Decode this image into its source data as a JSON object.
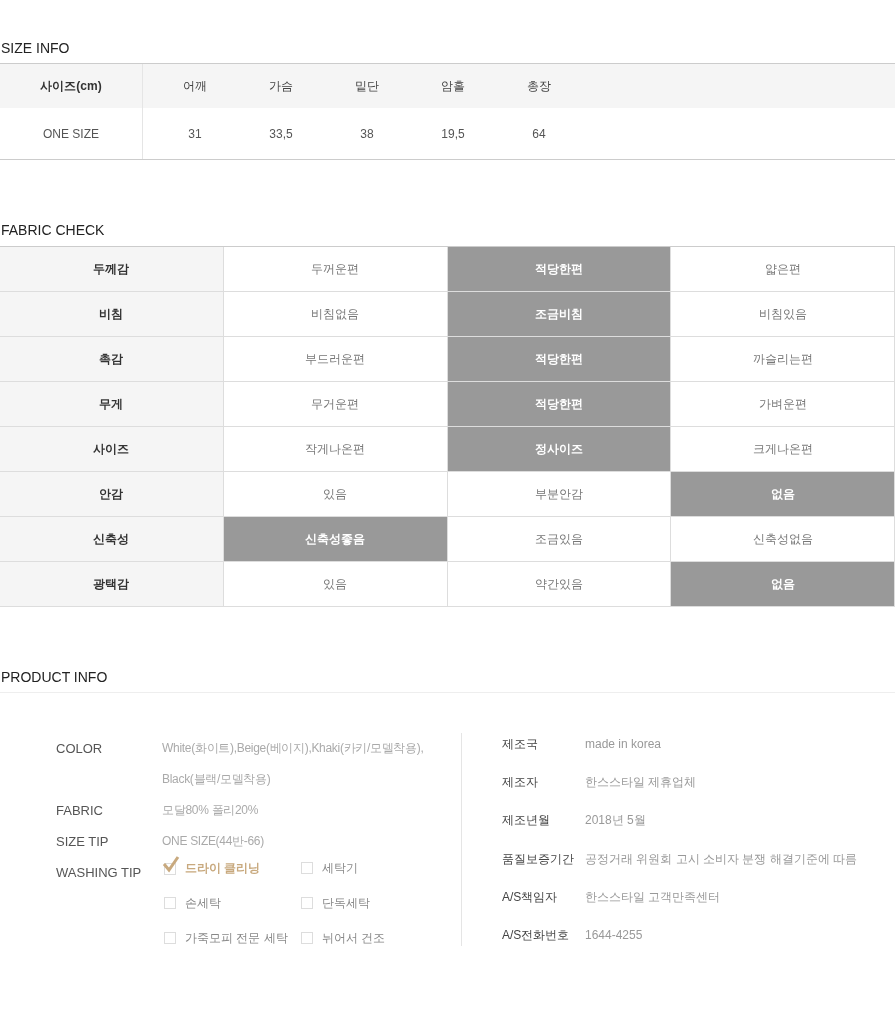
{
  "size_info": {
    "title": "SIZE INFO",
    "columns": [
      "사이즈(cm)",
      "어깨",
      "가슴",
      "밑단",
      "암홀",
      "총장"
    ],
    "rows": [
      [
        "ONE SIZE",
        "31",
        "33,5",
        "38",
        "19,5",
        "64"
      ]
    ]
  },
  "fabric_check": {
    "title": "FABRIC CHECK",
    "rows": [
      {
        "label": "두께감",
        "options": [
          {
            "text": "두꺼운편",
            "selected": false
          },
          {
            "text": "적당한편",
            "selected": true
          },
          {
            "text": "얇은편",
            "selected": false
          }
        ]
      },
      {
        "label": "비침",
        "options": [
          {
            "text": "비침없음",
            "selected": false
          },
          {
            "text": "조금비침",
            "selected": true
          },
          {
            "text": "비침있음",
            "selected": false
          }
        ]
      },
      {
        "label": "촉감",
        "options": [
          {
            "text": "부드러운편",
            "selected": false
          },
          {
            "text": "적당한편",
            "selected": true
          },
          {
            "text": "까슬리는편",
            "selected": false
          }
        ]
      },
      {
        "label": "무게",
        "options": [
          {
            "text": "무거운편",
            "selected": false
          },
          {
            "text": "적당한편",
            "selected": true
          },
          {
            "text": "가벼운편",
            "selected": false
          }
        ]
      },
      {
        "label": "사이즈",
        "options": [
          {
            "text": "작게나온편",
            "selected": false
          },
          {
            "text": "정사이즈",
            "selected": true
          },
          {
            "text": "크게나온편",
            "selected": false
          }
        ]
      },
      {
        "label": "안감",
        "options": [
          {
            "text": "있음",
            "selected": false
          },
          {
            "text": "부분안감",
            "selected": false
          },
          {
            "text": "없음",
            "selected": true
          }
        ]
      },
      {
        "label": "신축성",
        "options": [
          {
            "text": "신축성좋음",
            "selected": true
          },
          {
            "text": "조금있음",
            "selected": false
          },
          {
            "text": "신축성없음",
            "selected": false
          }
        ]
      },
      {
        "label": "광택감",
        "options": [
          {
            "text": "있음",
            "selected": false
          },
          {
            "text": "약간있음",
            "selected": false
          },
          {
            "text": "없음",
            "selected": true
          }
        ]
      }
    ]
  },
  "product_info": {
    "title": "PRODUCT INFO",
    "details": [
      {
        "label": "COLOR",
        "lines": [
          "White(화이트),Beige(베이지),Khaki(카키/모델착용),",
          "Black(블랙/모델착용)"
        ]
      },
      {
        "label": "FABRIC",
        "lines": [
          "모달80% 폴리20%"
        ]
      },
      {
        "label": "SIZE TIP",
        "lines": [
          "ONE SIZE(44반-66)"
        ]
      }
    ],
    "washing_tip": {
      "label": "WASHING TIP",
      "items": [
        {
          "label": "드라이 클리닝",
          "checked": true
        },
        {
          "label": "세탁기",
          "checked": false
        },
        {
          "label": "손세탁",
          "checked": false
        },
        {
          "label": "단독세탁",
          "checked": false
        },
        {
          "label": "가죽모피 전문 세탁",
          "checked": false
        },
        {
          "label": "뉘어서 건조",
          "checked": false
        }
      ]
    },
    "notice": [
      {
        "label": "제조국",
        "value": "made in korea"
      },
      {
        "label": "제조자",
        "value": "한스스타일 제휴업체"
      },
      {
        "label": "제조년월",
        "value": "2018년 5월"
      },
      {
        "label": "품질보증기간",
        "value": "공정거래 위원회 고시 소비자 분쟁 해결기준에 따름"
      },
      {
        "label": "A/S책임자",
        "value": "한스스타일 고객만족센터"
      },
      {
        "label": "A/S전화번호",
        "value": "1644-4255"
      }
    ]
  }
}
